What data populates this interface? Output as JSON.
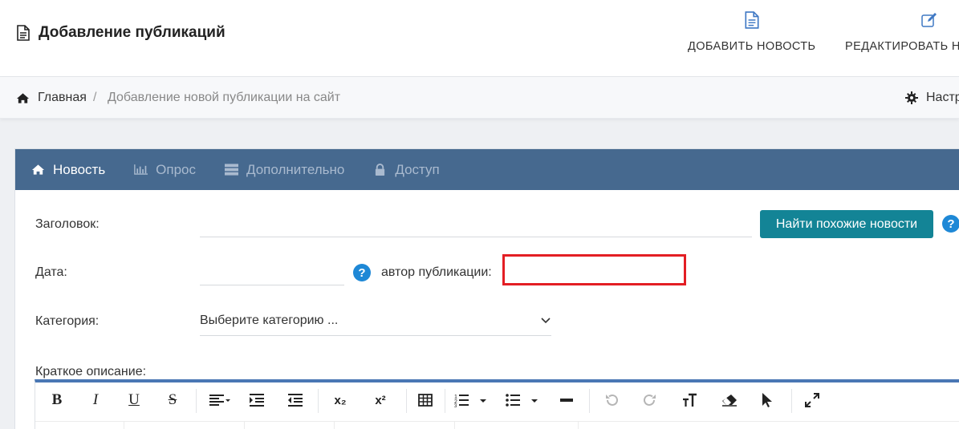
{
  "header": {
    "title": "Добавление публикаций",
    "actions": [
      {
        "label": "ДОБАВИТЬ НОВОСТЬ",
        "icon": "document-icon"
      },
      {
        "label": "РЕДАКТИРОВАТЬ Н",
        "icon": "edit-icon"
      }
    ]
  },
  "breadcrumb": {
    "home": "Главная",
    "separator": "/",
    "current": "Добавление новой публикации на сайт",
    "settings": "Настр"
  },
  "tabs": [
    {
      "label": "Новость",
      "icon": "home-icon",
      "active": true
    },
    {
      "label": "Опрос",
      "icon": "bar-chart-icon",
      "active": false
    },
    {
      "label": "Дополнительно",
      "icon": "list-icon",
      "active": false
    },
    {
      "label": "Доступ",
      "icon": "lock-icon",
      "active": false
    }
  ],
  "form": {
    "title_label": "Заголовок:",
    "title_value": "",
    "find_similar_button": "Найти похожие новости",
    "date_label": "Дата:",
    "date_value": "",
    "help_glyph": "?",
    "author_label": "автор публикации:",
    "author_value": "",
    "category_label": "Категория:",
    "category_selected": "Выберите категорию ...",
    "short_desc_label": "Краткое описание:"
  },
  "editor": {
    "toolbar": {
      "bold": "B",
      "italic": "I",
      "underline": "U",
      "strike": "S",
      "subscript": "x₂",
      "superscript": "x²"
    }
  },
  "colors": {
    "tab_bar": "#46698f",
    "accent_button": "#138496",
    "help_icon": "#1e88d6",
    "highlight_box": "#e31e24",
    "editor_border": "#4a77b4"
  }
}
